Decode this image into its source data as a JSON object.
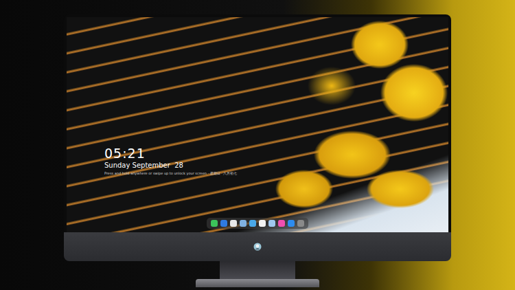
{
  "lock_screen": {
    "time": "05:21",
    "date": "Sunday September  28",
    "hint": "Press and hold anywhere or swipe up to unlock your screen · 星期日 · 八月初七"
  },
  "dock": [
    {
      "color": "#3cc45a"
    },
    {
      "color": "#2f7be0"
    },
    {
      "color": "#e8e8e8"
    },
    {
      "color": "#7fb0e0"
    },
    {
      "color": "#4aa8e8"
    },
    {
      "color": "#f2f2f2"
    },
    {
      "color": "#9fc7ee"
    },
    {
      "color": "#f04fb0"
    },
    {
      "color": "#2d8cf0"
    },
    {
      "color": "#8a8a8a"
    }
  ]
}
